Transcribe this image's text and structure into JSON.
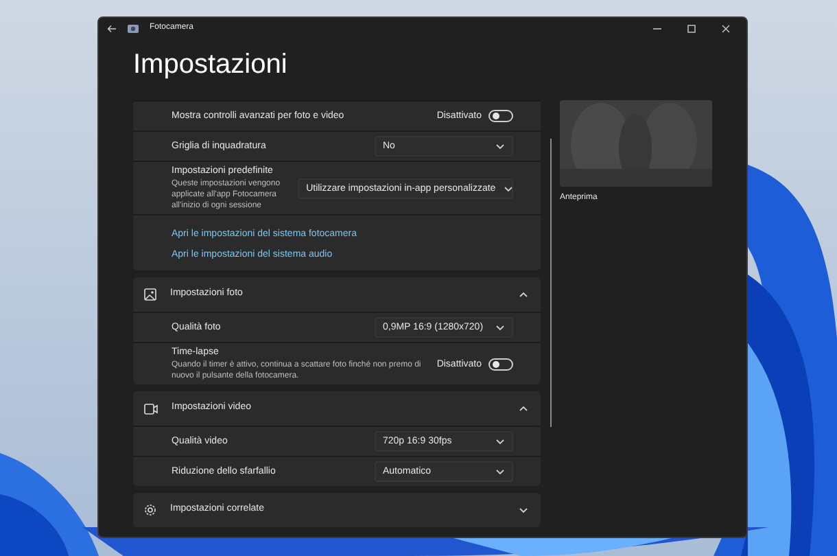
{
  "window": {
    "title": "Fotocamera",
    "heading": "Impostazioni"
  },
  "general": {
    "rows": [
      {
        "kind": "toggle",
        "label": "Mostra controlli avanzati per foto e video",
        "state_label": "Disattivato",
        "on": false
      },
      {
        "kind": "dropdown",
        "label": "Griglia di inquadratura",
        "value": "No"
      },
      {
        "kind": "dropdown",
        "label": "Impostazioni predefinite",
        "description": "Queste impostazioni vengono applicate all'app Fotocamera all'inizio di ogni sessione",
        "value": "Utilizzare impostazioni in-app personalizzate"
      }
    ],
    "links": [
      "Apri le impostazioni del sistema fotocamera",
      "Apri le impostazioni del sistema audio"
    ]
  },
  "sections": [
    {
      "title": "Impostazioni foto",
      "expanded": true,
      "rows": [
        {
          "kind": "dropdown",
          "label": "Qualità foto",
          "value": "0,9MP 16:9 (1280x720)"
        },
        {
          "kind": "toggle",
          "label": "Time-lapse",
          "description": "Quando il timer è attivo, continua a scattare foto finché non premo di nuovo il pulsante della fotocamera.",
          "state_label": "Disattivato",
          "on": false
        }
      ]
    },
    {
      "title": "Impostazioni video",
      "expanded": true,
      "rows": [
        {
          "kind": "dropdown",
          "label": "Qualità video",
          "value": "720p 16:9 30fps"
        },
        {
          "kind": "dropdown",
          "label": "Riduzione dello sfarfallio",
          "value": "Automatico"
        }
      ]
    },
    {
      "title": "Impostazioni correlate",
      "expanded": false
    }
  ],
  "preview": {
    "label": "Anteprima"
  }
}
